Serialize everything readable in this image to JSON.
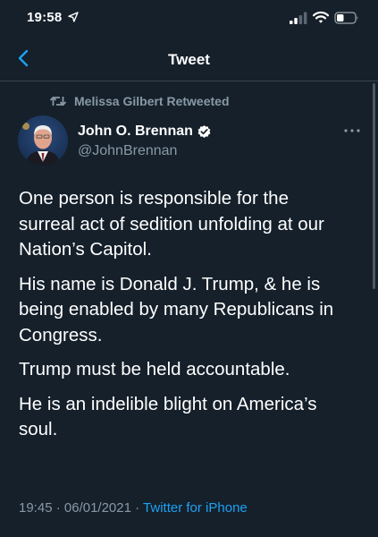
{
  "status_bar": {
    "time": "19:58"
  },
  "nav": {
    "title": "Tweet"
  },
  "retweet_context": {
    "text": "Melissa Gilbert Retweeted"
  },
  "author": {
    "name": "John O. Brennan",
    "handle": "@JohnBrennan",
    "verified": true
  },
  "tweet": {
    "paragraphs": [
      "One person is responsible for the\nsurreal act of sedition unfolding at our\nNation’s Capitol.",
      "His name is Donald J. Trump, & he is\nbeing enabled by many Republicans in\nCongress.",
      "Trump must be held accountable.",
      "He is an indelible blight on America’s\nsoul."
    ],
    "time": "19:45",
    "separator": "·",
    "date": "06/01/2021",
    "source": "Twitter for iPhone"
  },
  "colors": {
    "background": "#15202b",
    "accent": "#1da1f2",
    "secondary_text": "#8899a6",
    "divider": "#38444d"
  },
  "icons": {
    "back": "chevron-left-icon",
    "retweet": "retweet-icon",
    "verified": "verified-badge-icon",
    "more": "more-horizontal-icon",
    "location": "location-arrow-icon",
    "signal": "signal-icon",
    "wifi": "wifi-icon",
    "battery": "battery-icon"
  }
}
